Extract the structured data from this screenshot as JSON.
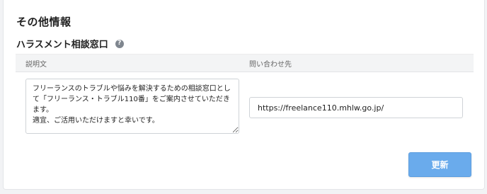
{
  "section": {
    "title": "その他情報"
  },
  "harassment": {
    "title": "ハラスメント相談窓口",
    "help_icon": "?",
    "columns": {
      "description": "説明文",
      "contact": "問い合わせ先"
    },
    "description_value": "フリーランスのトラブルや悩みを解決するための相談窓口として「フリーランス・トラブル110番」をご案内させていただきます。\n適宜、ご活用いただけますと幸いです。",
    "contact_value": "https://freelance110.mhlw.go.jp/"
  },
  "actions": {
    "update_label": "更新"
  },
  "colors": {
    "accent": "#6aabec",
    "help_icon_bg": "#7f868f",
    "header_bg": "#f3f4f5"
  }
}
